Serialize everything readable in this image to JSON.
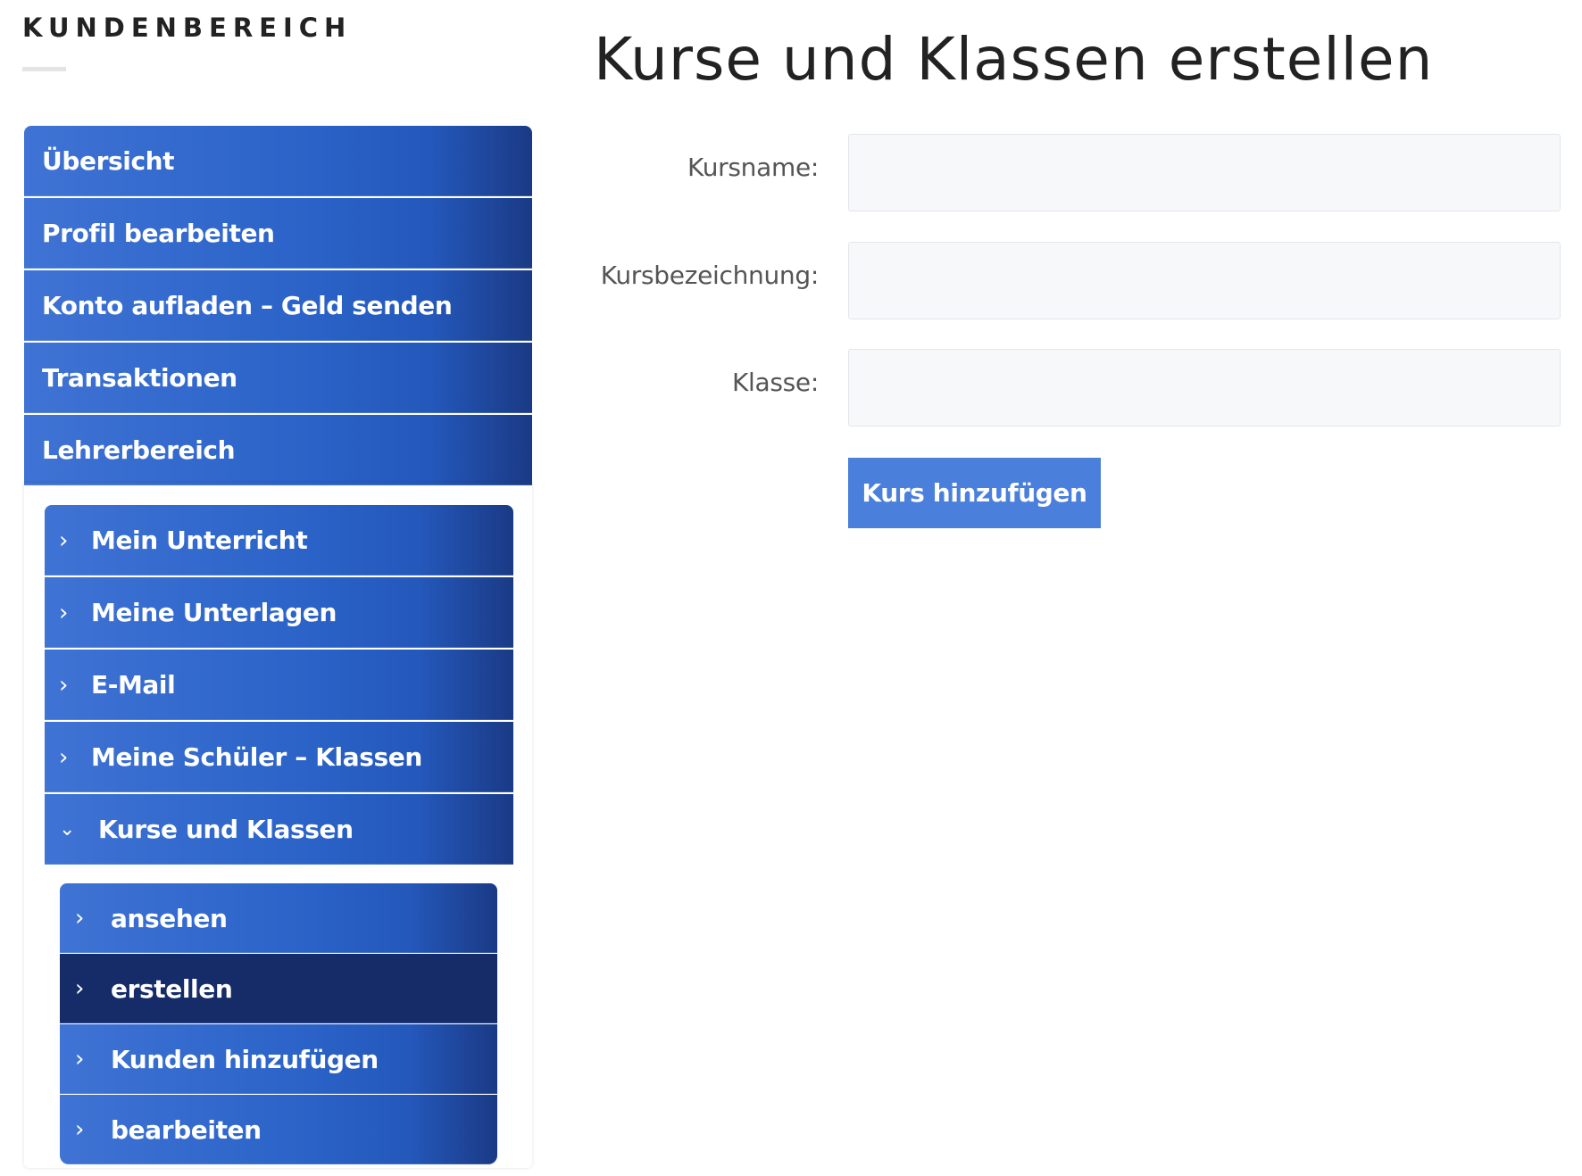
{
  "sidebar": {
    "title": "KUNDENBEREICH",
    "menu": [
      {
        "label": "Übersicht"
      },
      {
        "label": "Profil bearbeiten"
      },
      {
        "label": "Konto aufladen – Geld senden"
      },
      {
        "label": "Transaktionen"
      },
      {
        "label": "Lehrerbereich"
      }
    ],
    "submenu": [
      {
        "label": "Mein Unterricht",
        "icon": "chevron-right-icon"
      },
      {
        "label": "Meine Unterlagen",
        "icon": "chevron-right-icon"
      },
      {
        "label": "E-Mail",
        "icon": "chevron-right-icon"
      },
      {
        "label": "Meine Schüler – Klassen",
        "icon": "chevron-right-icon"
      },
      {
        "label": "Kurse und Klassen",
        "icon": "chevron-down-icon",
        "expanded": true
      }
    ],
    "subsubmenu": [
      {
        "label": "ansehen",
        "icon": "chevron-right-icon"
      },
      {
        "label": "erstellen",
        "icon": "chevron-right-icon",
        "active": true
      },
      {
        "label": "Kunden hinzufügen",
        "icon": "chevron-right-icon"
      },
      {
        "label": "bearbeiten",
        "icon": "chevron-right-icon"
      }
    ]
  },
  "main": {
    "title": "Kurse und Klassen erstellen",
    "form": {
      "fields": [
        {
          "label": "Kursname:",
          "value": ""
        },
        {
          "label": "Kursbezeichnung:",
          "value": ""
        },
        {
          "label": "Klasse:",
          "value": ""
        }
      ],
      "submit_label": "Kurs hinzufügen"
    }
  },
  "colors": {
    "menu_blue": "#2b63c8",
    "menu_blue_dark_edge": "#1a3a85",
    "menu_active": "#152c68",
    "button_blue": "#4a7fdb",
    "input_bg": "#f7f8fa"
  }
}
